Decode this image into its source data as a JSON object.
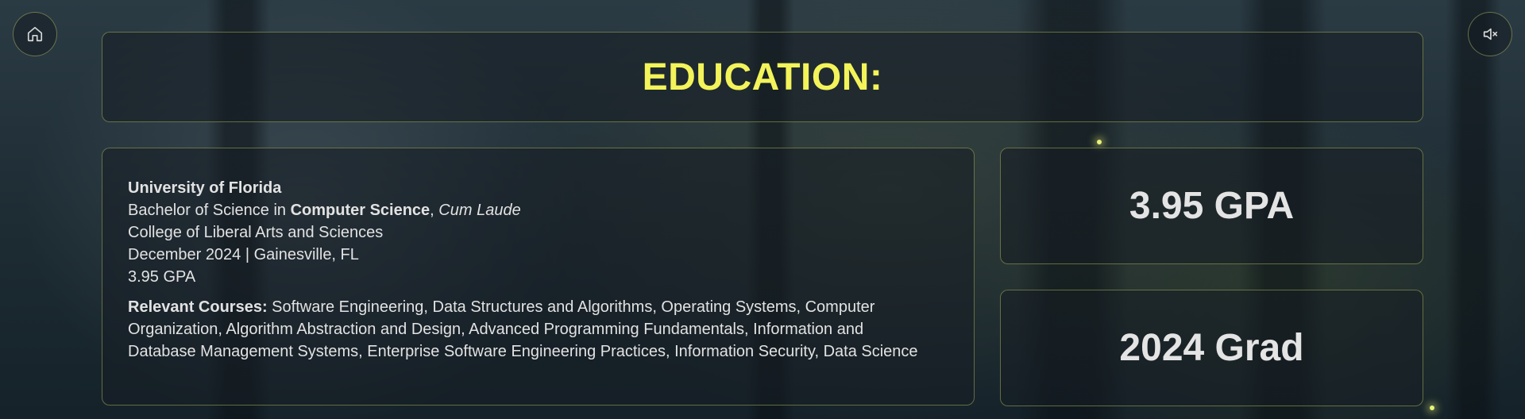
{
  "nav": {
    "home_icon": "home-icon",
    "mute_icon": "volume-mute-icon"
  },
  "header": {
    "title": "EDUCATION:"
  },
  "education": {
    "school": "University of Florida",
    "degree_prefix": "Bachelor of Science in ",
    "degree_major": "Computer Science",
    "degree_sep": ", ",
    "degree_honor": "Cum Laude",
    "college": "College of Liberal Arts and Sciences",
    "date_location": "December 2024 | Gainesville, FL",
    "gpa": "3.95 GPA",
    "courses_label": "Relevant Courses:",
    "courses_list": " Software Engineering, Data Structures and Algorithms, Operating Systems, Computer Organization, Algorithm Abstraction and Design, Advanced Programming Fundamentals, Information and Database Management Systems, Enterprise Software Engineering Practices, Information Security, Data Science"
  },
  "stats": {
    "gpa": "3.95 GPA",
    "grad": "2024 Grad"
  },
  "colors": {
    "accent": "#f3f35a",
    "border": "#bfcd64",
    "text": "#e2e2e2"
  }
}
